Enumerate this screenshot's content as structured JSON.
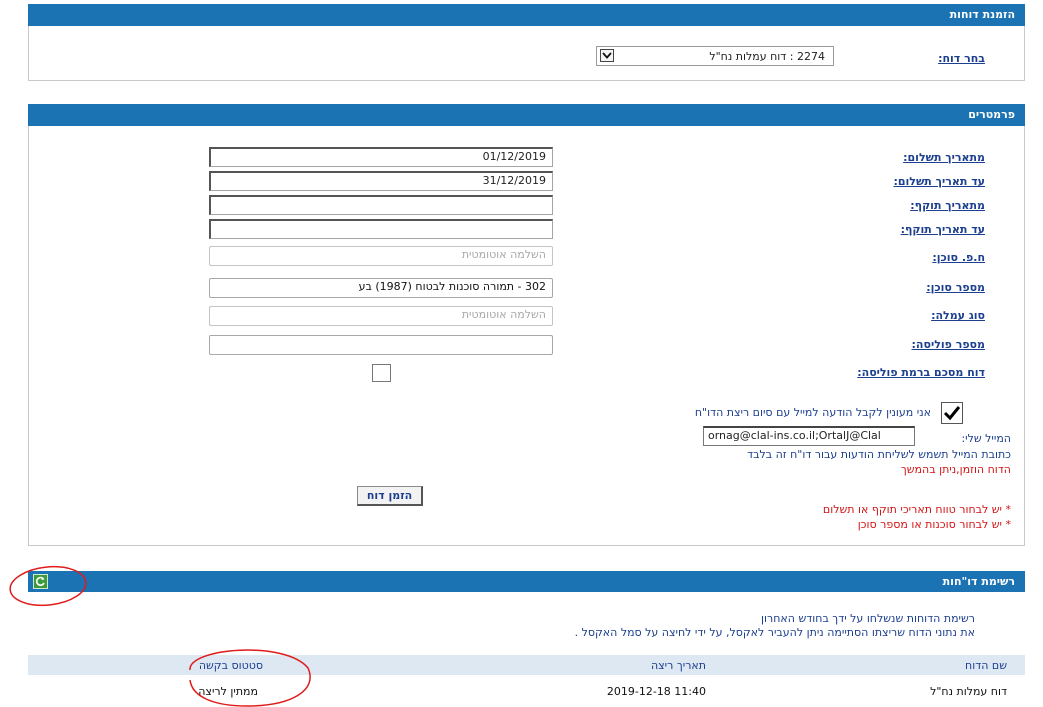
{
  "report_order": {
    "header": "הזמנת דוחות",
    "select_label": "בחר דוח:",
    "selected_report": "2274 : דוח עמלות נח\"ל"
  },
  "parameters": {
    "header": "פרמטרים",
    "fields": [
      {
        "label": "מתאריך תשלום:",
        "value": "01/12/2019",
        "placeholder": ""
      },
      {
        "label": "עד תאריך תשלום:",
        "value": "31/12/2019",
        "placeholder": ""
      },
      {
        "label": "מתאריך תוקף:",
        "value": "",
        "placeholder": ""
      },
      {
        "label": "עד תאריך תוקף:",
        "value": "",
        "placeholder": ""
      },
      {
        "label": "ח.פ. סוכן:",
        "value": "",
        "placeholder": "השלמה אוטומטית"
      },
      {
        "label": "מספר סוכן:",
        "value": "302 - תמורה סוכנות לבטוח (1987) בע",
        "placeholder": ""
      },
      {
        "label": "סוג עמלה:",
        "value": "",
        "placeholder": "השלמה אוטומטית"
      },
      {
        "label": "מספר פוליסה:",
        "value": "",
        "placeholder": ""
      }
    ],
    "summary_label": "דוח מסכם ברמת פוליסה:",
    "summary_checked": false,
    "notify_label": "אני מעונין לקבל הודעה למייל עם סיום ריצת הדו\"ח",
    "notify_checked": true,
    "email_label": "המייל שלי:",
    "email_value": "ornag@clal-ins.co.il;OrtalJ@Clal",
    "email_note": "כתובת המייל תשמש לשליחת הודעות עבור דו\"ח זה בלבד",
    "ordered_message": "הדוח הוזמן,ניתן בהמשך",
    "order_button": "הזמן דוח",
    "error_1": "* יש לבחור טווח תאריכי תוקף או תשלום",
    "error_2": "* יש לבחור סוכנות או מספר סוכן"
  },
  "reports_list": {
    "header": "רשימת דו\"חות",
    "info_1": "רשימת הדוחות שנשלחו על ידך בחודש האחרון",
    "info_2": "את נתוני הדוח שריצתו הסתיימה ניתן להעביר לאקסל, על ידי לחיצה על סמל האקסל .",
    "columns": [
      "שם הדוח",
      "תאריך ריצה",
      "סטטוס בקשה"
    ],
    "rows": [
      {
        "name": "דוח עמלות נח\"ל",
        "run_date": "11:40 2019-12-18",
        "status": "ממתין לריצה"
      }
    ]
  },
  "colors": {
    "header_blue": "#1b73b3",
    "label_blue": "#1c3f8f",
    "error_red": "#d31515",
    "annotation_red": "#e01b1b"
  },
  "icons": {
    "refresh": "refresh-icon",
    "dropdown": "chevron-down-icon",
    "checkmark": "checkmark-icon"
  }
}
